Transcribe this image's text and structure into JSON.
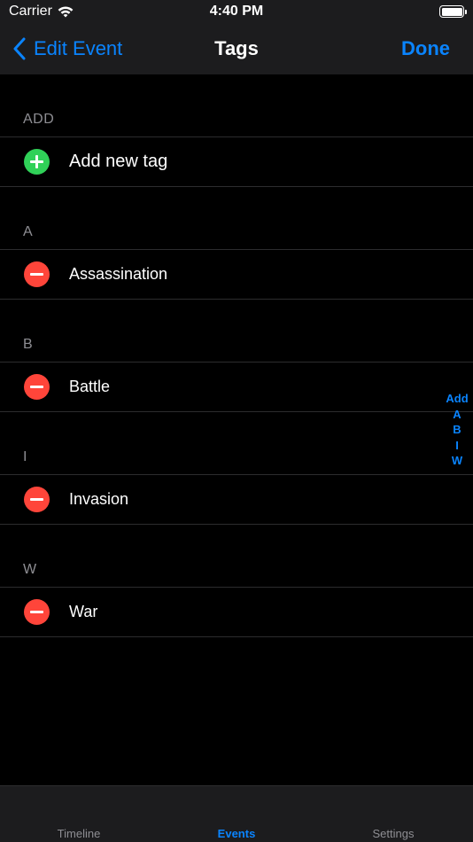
{
  "status_bar": {
    "carrier": "Carrier",
    "time": "4:40 PM"
  },
  "nav": {
    "back_label": "Edit Event",
    "title": "Tags",
    "done_label": "Done"
  },
  "sections": [
    {
      "header": "ADD",
      "row": {
        "label": "Add new tag",
        "action": "add"
      }
    },
    {
      "header": "A",
      "row": {
        "label": "Assassination",
        "action": "remove"
      }
    },
    {
      "header": "B",
      "row": {
        "label": "Battle",
        "action": "remove"
      }
    },
    {
      "header": "I",
      "row": {
        "label": "Invasion",
        "action": "remove"
      }
    },
    {
      "header": "W",
      "row": {
        "label": "War",
        "action": "remove"
      }
    }
  ],
  "index": [
    "Add",
    "A",
    "B",
    "I",
    "W"
  ],
  "tabs": [
    {
      "label": "Timeline",
      "active": false
    },
    {
      "label": "Events",
      "active": true
    },
    {
      "label": "Settings",
      "active": false
    }
  ],
  "colors": {
    "accent": "#0a84ff",
    "add": "#30d158",
    "remove": "#ff453a",
    "background": "#000000"
  }
}
